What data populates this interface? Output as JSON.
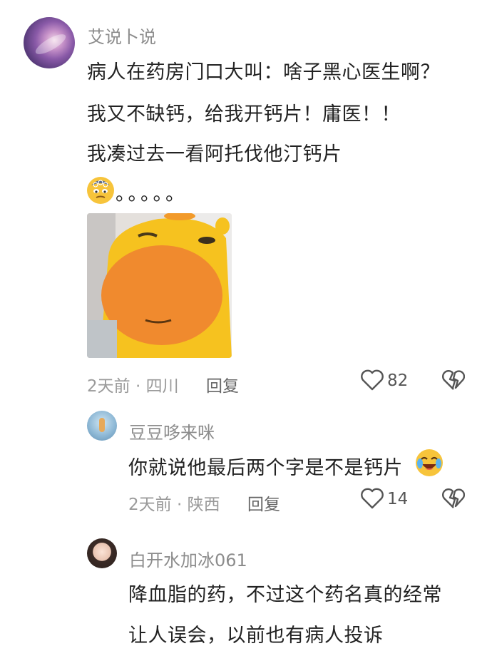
{
  "comment1": {
    "username": "艾说卜说",
    "lines": [
      "病人在药房门口大叫：啥子黑心医生啊？",
      "我又不缺钙，给我开钙片！庸医！！",
      "我凑过去一看阿托伐他汀钙片"
    ],
    "trailing_text": "。。。。。",
    "emoji_icon": "dizzy-face-emoji",
    "sticker_icon": "yellow-hippo-sticker",
    "meta": "2天前 · 四川",
    "reply_label": "回复",
    "like_count": "82"
  },
  "reply1": {
    "username": "豆豆哆来咪",
    "text": "你就说他最后两个字是不是钙片",
    "emoji_icon": "laughing-crying-emoji",
    "meta": "2天前 · 陕西",
    "reply_label": "回复",
    "like_count": "14"
  },
  "reply2": {
    "username": "白开水加冰061",
    "lines": [
      "降血脂的药，不过这个药名真的经常",
      "让人误会，以前也有病人投诉"
    ]
  },
  "colors": {
    "username": "#8c8c8c",
    "text": "#222222",
    "meta": "#9a9a9a",
    "sticker_body": "#f6c21f",
    "sticker_snout": "#f08a2e"
  }
}
